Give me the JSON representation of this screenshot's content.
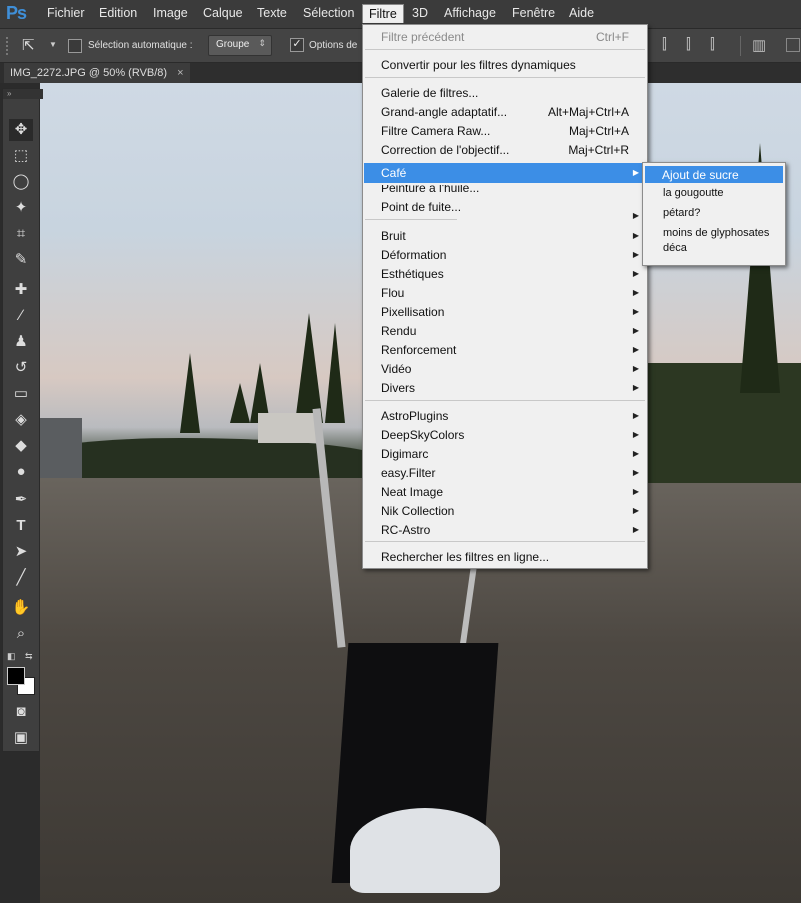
{
  "app": {
    "logo": "Ps"
  },
  "menubar": {
    "items": [
      "Fichier",
      "Edition",
      "Image",
      "Calque",
      "Texte",
      "Sélection",
      "Filtre",
      "3D",
      "Affichage",
      "Fenêtre",
      "Aide"
    ],
    "active": "Filtre"
  },
  "options": {
    "auto_select_label": "Sélection automatique :",
    "auto_select_value": "Groupe",
    "transform_label": "Options de"
  },
  "document": {
    "tab_label": "IMG_2272.JPG @ 50% (RVB/8)",
    "close": "×"
  },
  "tools": [
    "move-tool-icon",
    "marquee-tool-icon",
    "lasso-tool-icon",
    "magic-wand-icon",
    "crop-tool-icon",
    "eyedropper-icon",
    "healing-brush-icon",
    "brush-tool-icon",
    "clone-stamp-icon",
    "history-brush-icon",
    "eraser-icon",
    "paint-bucket-icon",
    "blur-tool-icon",
    "dodge-tool-icon",
    "pen-tool-icon",
    "type-tool-icon",
    "path-selection-icon",
    "line-tool-icon",
    "hand-tool-icon",
    "zoom-tool-icon"
  ],
  "filter_menu": {
    "last_filter": "Filtre précédent",
    "last_filter_shortcut": "Ctrl+F",
    "convert_smart": "Convertir pour les filtres dynamiques",
    "gallery": "Galerie de filtres...",
    "adaptive_wide": "Grand-angle adaptatif...",
    "adaptive_wide_shortcut": "Alt+Maj+Ctrl+A",
    "camera_raw": "Filtre Camera Raw...",
    "camera_raw_shortcut": "Maj+Ctrl+A",
    "lens_correction": "Correction de l'objectif...",
    "lens_correction_shortcut": "Maj+Ctrl+R",
    "cafe": "Café",
    "oil_paint": "Peinture à l'huile...",
    "vanishing_point": "Point de fuite...",
    "group1": [
      "Bruit",
      "Déformation",
      "Esthétiques",
      "Flou",
      "Pixellisation",
      "Rendu",
      "Renforcement",
      "Vidéo",
      "Divers"
    ],
    "group2": [
      "AstroPlugins",
      "DeepSkyColors",
      "Digimarc",
      "easy.Filter",
      "Neat Image",
      "Nik Collection",
      "RC-Astro"
    ],
    "browse_online": "Rechercher les filtres en ligne..."
  },
  "cafe_submenu": {
    "items": [
      "Ajout de sucre",
      "la gougoutte",
      "pétard?",
      "moins de glyphosates",
      "déca"
    ]
  },
  "colors": {
    "highlight": "#3c8ee6",
    "menu_bg": "#f0f0f0",
    "chrome": "#3b3b3b"
  }
}
